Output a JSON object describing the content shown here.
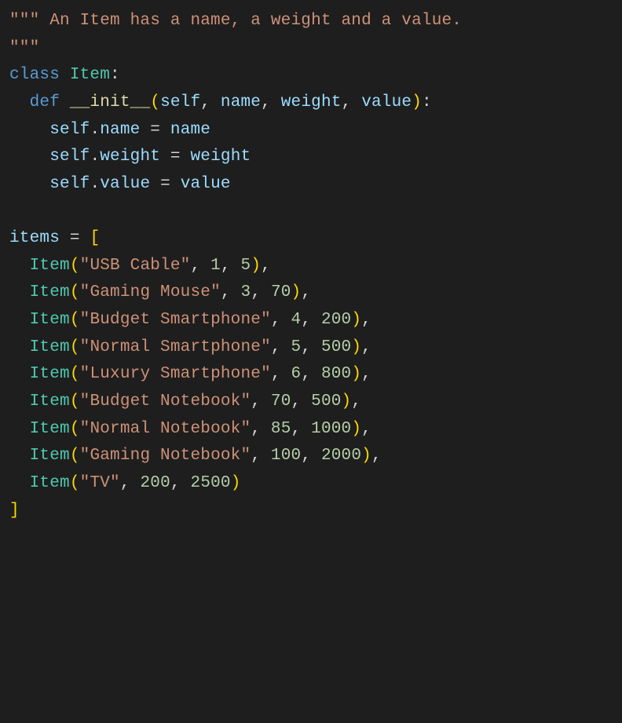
{
  "code": {
    "docstring_open": "\"\"\"",
    "docstring": "An Item has a name, a weight and a value.",
    "docstring_close": "\"\"\"",
    "class_kw": "class",
    "class_name": "Item",
    "def_kw": "def",
    "init_name": "__init__",
    "init_params": [
      "self",
      "name",
      "weight",
      "value"
    ],
    "self": "self",
    "attrs": [
      "name",
      "weight",
      "value"
    ],
    "list_var": "items",
    "items": [
      {
        "qname": "\"USB Cable\"",
        "weight": "1",
        "value": "5"
      },
      {
        "qname": "\"Gaming Mouse\"",
        "weight": "3",
        "value": "70"
      },
      {
        "qname": "\"Budget Smartphone\"",
        "weight": "4",
        "value": "200"
      },
      {
        "qname": "\"Normal Smartphone\"",
        "weight": "5",
        "value": "500"
      },
      {
        "qname": "\"Luxury Smartphone\"",
        "weight": "6",
        "value": "800"
      },
      {
        "qname": "\"Budget Notebook\"",
        "weight": "70",
        "value": "500"
      },
      {
        "qname": "\"Normal Notebook\"",
        "weight": "85",
        "value": "1000"
      },
      {
        "qname": "\"Gaming Notebook\"",
        "weight": "100",
        "value": "2000"
      },
      {
        "qname": "\"TV\"",
        "weight": "200",
        "value": "2500"
      }
    ]
  }
}
